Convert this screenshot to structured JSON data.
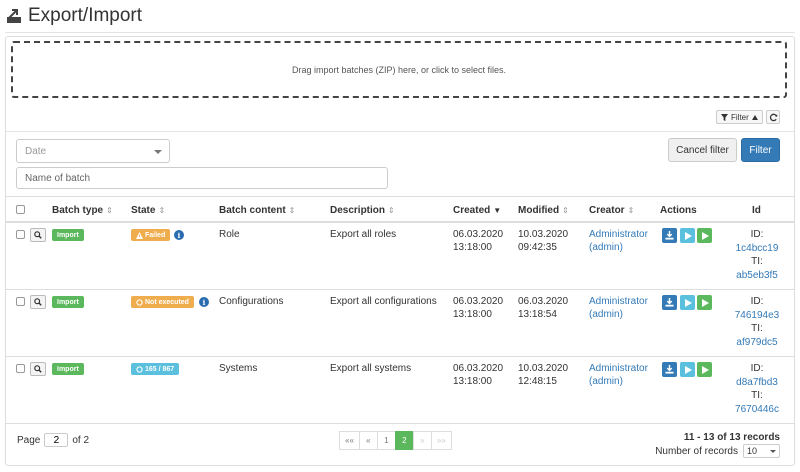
{
  "page": {
    "title": "Export/Import"
  },
  "dropzone": {
    "text": "Drag import batches (ZIP) here, or click to select files."
  },
  "toolbar": {
    "filter_toggle_label": "Filter"
  },
  "filters": {
    "date_placeholder": "Date",
    "name_placeholder": "Name of batch",
    "cancel_label": "Cancel filter",
    "filter_label": "Filter"
  },
  "table": {
    "columns": {
      "batch_type": "Batch type",
      "state": "State",
      "batch_content": "Batch content",
      "description": "Description",
      "created": "Created",
      "modified": "Modified",
      "creator": "Creator",
      "actions": "Actions",
      "id": "Id"
    },
    "rows": [
      {
        "type": "Import",
        "state": "Failed",
        "content": "Role",
        "description": "Export all roles",
        "created_date": "06.03.2020",
        "created_time": "13:18:00",
        "modified_date": "10.03.2020",
        "modified_time": "09:42:35",
        "creator_name": "Administrator",
        "creator_login": "(admin)",
        "id_label": "ID:",
        "id_value": "1c4bcc19",
        "ti_label": "TI:",
        "ti_value": "ab5eb3f5"
      },
      {
        "type": "Import",
        "state": "Not executed",
        "content": "Configurations",
        "description": "Export all configurations",
        "created_date": "06.03.2020",
        "created_time": "13:18:00",
        "modified_date": "06.03.2020",
        "modified_time": "13:18:54",
        "creator_name": "Administrator",
        "creator_login": "(admin)",
        "id_label": "ID:",
        "id_value": "746194e3",
        "ti_label": "TI:",
        "ti_value": "af979dc5"
      },
      {
        "type": "Import",
        "state": "165 / 867",
        "content": "Systems",
        "description": "Export all systems",
        "created_date": "06.03.2020",
        "created_time": "13:18:00",
        "modified_date": "10.03.2020",
        "modified_time": "12:48:15",
        "creator_name": "Administrator",
        "creator_login": "(admin)",
        "id_label": "ID:",
        "id_value": "d8a7fbd3",
        "ti_label": "TI:",
        "ti_value": "7670446c"
      }
    ]
  },
  "pager": {
    "page_label": "Page",
    "page_value": "2",
    "of_label": "of 2",
    "first": "««",
    "prev": "«",
    "pages": [
      "1",
      "2"
    ],
    "next": "»",
    "last": "»»",
    "range_text": "11 - 13 of 13 records",
    "records_label": "Number of records",
    "records_value": "10"
  },
  "colors": {
    "primary": "#337ab7",
    "success": "#5cb85c",
    "warning": "#f0ad4e",
    "info": "#5bc0de"
  }
}
